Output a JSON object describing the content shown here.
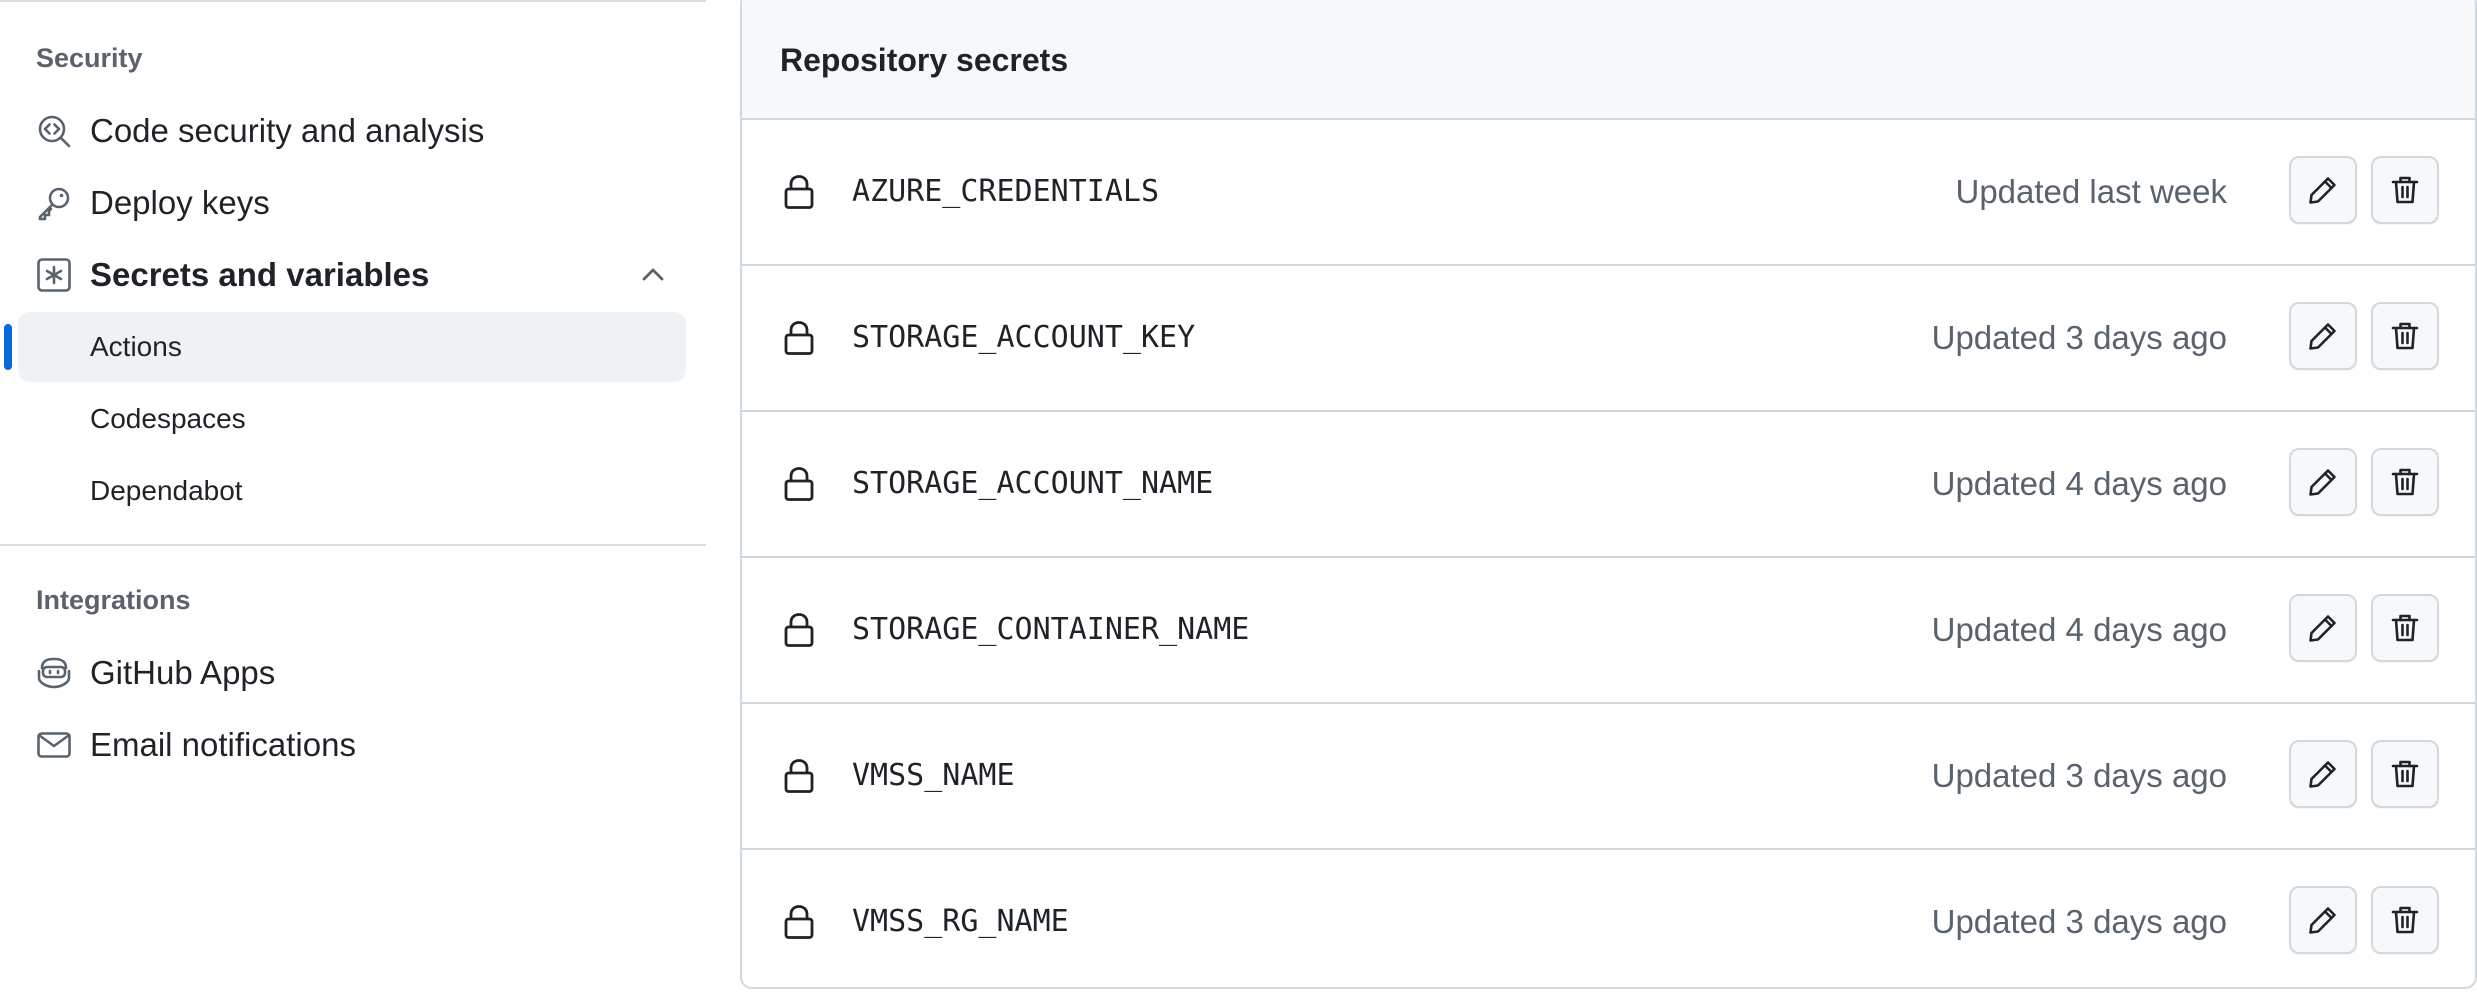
{
  "sidebar": {
    "security_heading": "Security",
    "code_security": "Code security and analysis",
    "deploy_keys": "Deploy keys",
    "secrets_variables": "Secrets and variables",
    "sub_actions": "Actions",
    "sub_codespaces": "Codespaces",
    "sub_dependabot": "Dependabot",
    "integrations_heading": "Integrations",
    "github_apps": "GitHub Apps",
    "email_notifications": "Email notifications"
  },
  "secrets": {
    "title": "Repository secrets",
    "rows": [
      {
        "name": "AZURE_CREDENTIALS",
        "updated": "Updated last week"
      },
      {
        "name": "STORAGE_ACCOUNT_KEY",
        "updated": "Updated 3 days ago"
      },
      {
        "name": "STORAGE_ACCOUNT_NAME",
        "updated": "Updated 4 days ago"
      },
      {
        "name": "STORAGE_CONTAINER_NAME",
        "updated": "Updated 4 days ago"
      },
      {
        "name": "VMSS_NAME",
        "updated": "Updated 3 days ago"
      },
      {
        "name": "VMSS_RG_NAME",
        "updated": "Updated 3 days ago"
      }
    ]
  },
  "icons": {
    "code_security": "codescan-icon",
    "deploy_keys": "key-icon",
    "secrets": "asterisk-box-icon",
    "chevron": "chevron-up-icon",
    "github_apps": "copilot-app-icon",
    "email": "mail-icon",
    "secret_row": "lock-icon",
    "edit": "pencil-icon",
    "delete": "trash-icon"
  },
  "colors": {
    "accent": "#0969da",
    "muted_text": "#59636e",
    "border": "#d1d9e0",
    "active_bg": "#eff2f5"
  }
}
